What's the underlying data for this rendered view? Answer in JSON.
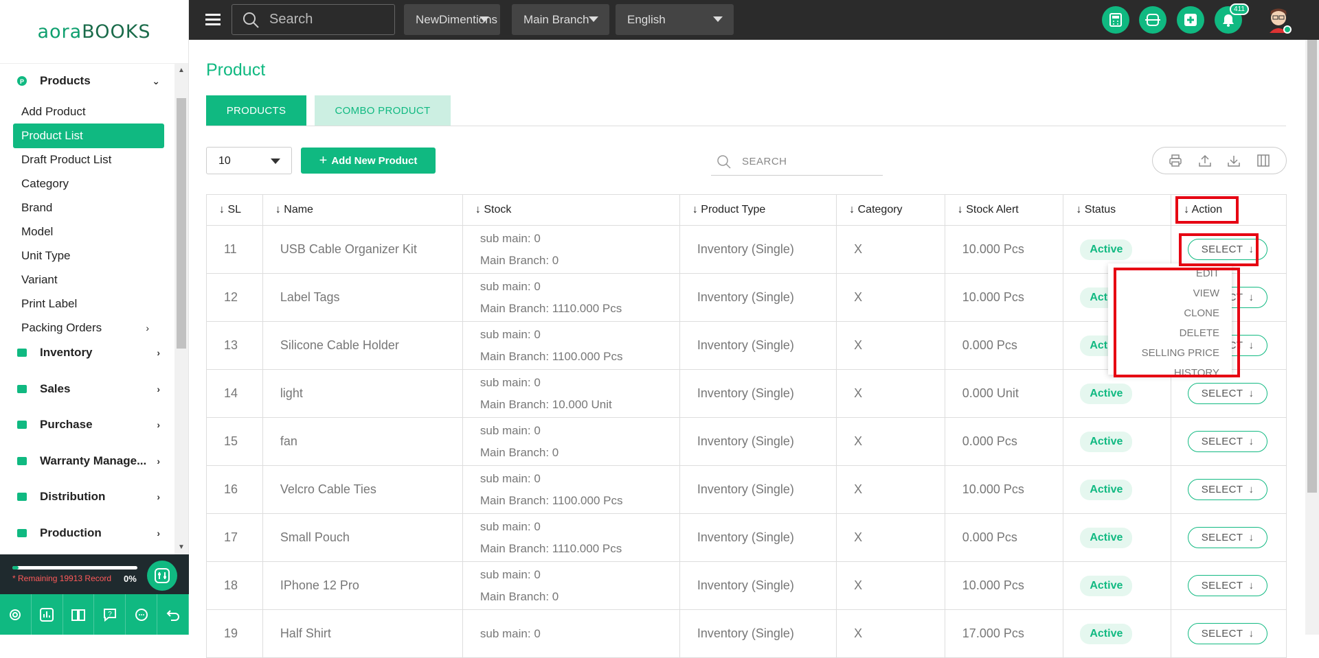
{
  "brand": {
    "logo_a": "aora",
    "logo_b": "BOOKS"
  },
  "sidebar": {
    "products": {
      "label": "Products"
    },
    "product_items": [
      "Add Product",
      "Product List",
      "Draft Product List",
      "Category",
      "Brand",
      "Model",
      "Unit Type",
      "Variant",
      "Print Label",
      "Packing Orders"
    ],
    "sections": [
      "Inventory",
      "Sales",
      "Purchase",
      "Warranty Manage...",
      "Distribution",
      "Production"
    ],
    "remaining": "* Remaining 19913 Record",
    "percent": "0%",
    "progress_fraction": 0.05
  },
  "topbar": {
    "search_placeholder": "Search",
    "company": "NewDimentions",
    "branch": "Main Branch",
    "language": "English",
    "notification_count": "411"
  },
  "page": {
    "title": "Product",
    "tabs": [
      "PRODUCTS",
      "COMBO PRODUCT"
    ],
    "per_page": "10",
    "add_button": "Add New Product",
    "search_placeholder": "SEARCH"
  },
  "table": {
    "headers": [
      "SL",
      "Name",
      "Stock",
      "Product Type",
      "Category",
      "Stock Alert",
      "Status",
      "Action"
    ],
    "rows": [
      {
        "sl": "11",
        "name": "USB Cable Organizer Kit",
        "stock1": "sub main: 0",
        "stock2": "Main Branch: 0",
        "type": "Inventory (Single)",
        "category": "X",
        "alert": "10.000 Pcs",
        "status": "Active",
        "action": "SELECT"
      },
      {
        "sl": "12",
        "name": "Label Tags",
        "stock1": "sub main: 0",
        "stock2": "Main Branch: 1110.000 Pcs",
        "type": "Inventory (Single)",
        "category": "X",
        "alert": "10.000 Pcs",
        "status": "Active",
        "action": "SELECT"
      },
      {
        "sl": "13",
        "name": "Silicone Cable Holder",
        "stock1": "sub main: 0",
        "stock2": "Main Branch: 1100.000 Pcs",
        "type": "Inventory (Single)",
        "category": "X",
        "alert": "0.000 Pcs",
        "status": "Active",
        "action": "SELECT"
      },
      {
        "sl": "14",
        "name": "light",
        "stock1": "sub main: 0",
        "stock2": "Main Branch: 10.000 Unit",
        "type": "Inventory (Single)",
        "category": "X",
        "alert": "0.000 Unit",
        "status": "Active",
        "action": "SELECT"
      },
      {
        "sl": "15",
        "name": "fan",
        "stock1": "sub main: 0",
        "stock2": "Main Branch: 0",
        "type": "Inventory (Single)",
        "category": "X",
        "alert": "0.000 Pcs",
        "status": "Active",
        "action": "SELECT"
      },
      {
        "sl": "16",
        "name": "Velcro Cable Ties",
        "stock1": "sub main: 0",
        "stock2": "Main Branch: 1100.000 Pcs",
        "type": "Inventory (Single)",
        "category": "X",
        "alert": "10.000 Pcs",
        "status": "Active",
        "action": "SELECT"
      },
      {
        "sl": "17",
        "name": "Small Pouch",
        "stock1": "sub main: 0",
        "stock2": "Main Branch: 1110.000 Pcs",
        "type": "Inventory (Single)",
        "category": "X",
        "alert": "0.000 Pcs",
        "status": "Active",
        "action": "SELECT"
      },
      {
        "sl": "18",
        "name": "IPhone 12 Pro",
        "stock1": "sub main: 0",
        "stock2": "Main Branch: 0",
        "type": "Inventory (Single)",
        "category": "X",
        "alert": "10.000 Pcs",
        "status": "Active",
        "action": "SELECT"
      },
      {
        "sl": "19",
        "name": "Half Shirt",
        "stock1": "sub main: 0",
        "stock2": "",
        "type": "Inventory (Single)",
        "category": "X",
        "alert": "17.000 Pcs",
        "status": "Active",
        "action": "SELECT"
      }
    ]
  },
  "action_menu": [
    "EDIT",
    "VIEW",
    "CLONE",
    "DELETE",
    "SELLING PRICE HISTORY"
  ],
  "colors": {
    "accent": "#10b981",
    "topbar": "#2b2b2b",
    "highlight": "#e60012"
  }
}
